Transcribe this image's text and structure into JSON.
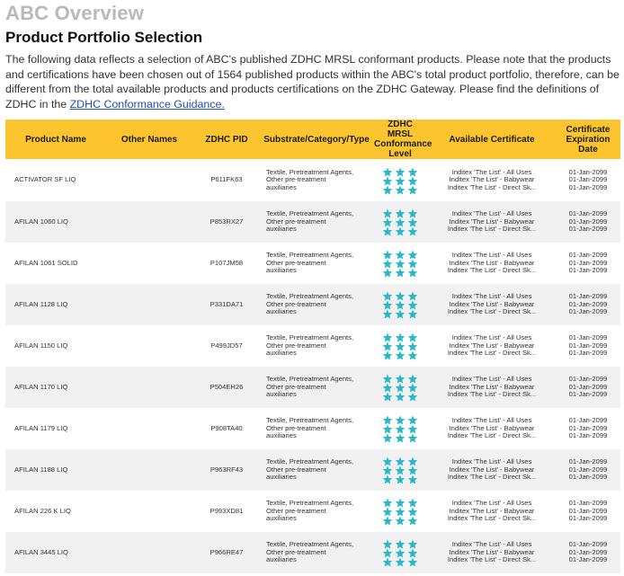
{
  "page": {
    "overview_title": "ABC Overview",
    "section_title": "Product Portfolio Selection",
    "intro_text": "The following data reflects a selection of ABC's published ZDHC MRSL conformant products. Please note that the products and certifications have been chosen out of 1564 published products within the ABC's total product portfolio, therefore, can be different from the total available products and products certifications on the ZDHC Gateway.  Please find the definitions of ZDHC in the ",
    "intro_link": "ZDHC Conformance Guidance.",
    "accent_color": "#fcc52f",
    "star_color": "#29b8c9",
    "link_color": "#1f4fb4"
  },
  "table": {
    "headers": {
      "product_name": "Product Name",
      "other_names": "Other Names",
      "pid": "ZDHC PID",
      "substrate": "Substrate/Category/Type",
      "mrsl_line1": "ZDHC MRSL",
      "mrsl_line2": "Conformance",
      "mrsl_line3": "Level",
      "certificate": "Available Certificate",
      "exp_line1": "Certificate",
      "exp_line2": "Expiration",
      "exp_line3": "Date"
    },
    "rows": [
      {
        "name": "ACTIVATOR SF LIQ",
        "other": "",
        "pid": "P611FK63",
        "sub1": "Textile, Pretreatment Agents,",
        "sub2": "Other pre-treatment",
        "sub3": "auxiliaries",
        "level": 3,
        "cert1": "Inditex 'The List' - All Uses",
        "cert2": "Inditex 'The List' - Babywear",
        "cert3": "Inditex 'The List' - Direct Sk...",
        "exp1": "01-Jan-2099",
        "exp2": "01-Jan-2099",
        "exp3": "01-Jan-2099"
      },
      {
        "name": "AFILAN 1060 LIQ",
        "other": "",
        "pid": "P853RX27",
        "sub1": "Textile, Pretreatment Agents,",
        "sub2": "Other pre-treatment",
        "sub3": "auxiliaries",
        "level": 3,
        "cert1": "Inditex 'The List' - All Uses",
        "cert2": "Inditex 'The List' - Babywear",
        "cert3": "Inditex 'The List' - Direct Sk...",
        "exp1": "01-Jan-2099",
        "exp2": "01-Jan-2099",
        "exp3": "01-Jan-2099"
      },
      {
        "name": "AFILAN 1061 SOLID",
        "other": "",
        "pid": "P107JM58",
        "sub1": "Textile, Pretreatment Agents,",
        "sub2": "Other pre-treatment",
        "sub3": "auxiliaries",
        "level": 3,
        "cert1": "Inditex 'The List' - All Uses",
        "cert2": "Inditex 'The List' - Babywear",
        "cert3": "Inditex 'The List' - Direct Sk...",
        "exp1": "01-Jan-2099",
        "exp2": "01-Jan-2099",
        "exp3": "01-Jan-2099"
      },
      {
        "name": "AFILAN 1128 LIQ",
        "other": "",
        "pid": "P331DA71",
        "sub1": "Textile, Pretreatment Agents,",
        "sub2": "Other pre-treatment",
        "sub3": "auxiliaries",
        "level": 3,
        "cert1": "Inditex 'The List' - All Uses",
        "cert2": "Inditex 'The List' - Babywear",
        "cert3": "Inditex 'The List' - Direct Sk...",
        "exp1": "01-Jan-2099",
        "exp2": "01-Jan-2099",
        "exp3": "01-Jan-2099"
      },
      {
        "name": "AFILAN 1150 LIQ",
        "other": "",
        "pid": "P499JD57",
        "sub1": "Textile, Pretreatment Agents,",
        "sub2": "Other pre-treatment",
        "sub3": "auxiliaries",
        "level": 3,
        "cert1": "Inditex 'The List' - All Uses",
        "cert2": "Inditex 'The List' - Babywear",
        "cert3": "Inditex 'The List' - Direct Sk...",
        "exp1": "01-Jan-2099",
        "exp2": "01-Jan-2099",
        "exp3": "01-Jan-2099"
      },
      {
        "name": "AFILAN 1170 LIQ",
        "other": "",
        "pid": "P504EH26",
        "sub1": "Textile, Pretreatment Agents,",
        "sub2": "Other pre-treatment",
        "sub3": "auxiliaries",
        "level": 3,
        "cert1": "Inditex 'The List' - All Uses",
        "cert2": "Inditex 'The List' - Babywear",
        "cert3": "Inditex 'The List' - Direct Sk...",
        "exp1": "01-Jan-2099",
        "exp2": "01-Jan-2099",
        "exp3": "01-Jan-2099"
      },
      {
        "name": "AFILAN 1179 LIQ",
        "other": "",
        "pid": "P908TA40",
        "sub1": "Textile, Pretreatment Agents,",
        "sub2": "Other pre-treatment",
        "sub3": "auxiliaries",
        "level": 3,
        "cert1": "Inditex 'The List' - All Uses",
        "cert2": "Inditex 'The List' - Babywear",
        "cert3": "Inditex 'The List' - Direct Sk...",
        "exp1": "01-Jan-2099",
        "exp2": "01-Jan-2099",
        "exp3": "01-Jan-2099"
      },
      {
        "name": "AFILAN 1188 LIQ",
        "other": "",
        "pid": "P963RF43",
        "sub1": "Textile, Pretreatment Agents,",
        "sub2": "Other pre-treatment",
        "sub3": "auxiliaries",
        "level": 3,
        "cert1": "Inditex 'The List' - All Uses",
        "cert2": "Inditex 'The List' - Babywear",
        "cert3": "Inditex 'The List' - Direct Sk...",
        "exp1": "01-Jan-2099",
        "exp2": "01-Jan-2099",
        "exp3": "01-Jan-2099"
      },
      {
        "name": "AFILAN 226 K LIQ",
        "other": "",
        "pid": "P993XD81",
        "sub1": "Textile, Pretreatment Agents,",
        "sub2": "Other pre-treatment",
        "sub3": "auxiliaries",
        "level": 3,
        "cert1": "Inditex 'The List' - All Uses",
        "cert2": "Inditex 'The List' - Babywear",
        "cert3": "Inditex 'The List' - Direct Sk...",
        "exp1": "01-Jan-2099",
        "exp2": "01-Jan-2099",
        "exp3": "01-Jan-2099"
      },
      {
        "name": "AFILAN 3445 LIQ",
        "other": "",
        "pid": "P966RE47",
        "sub1": "Textile, Pretreatment Agents,",
        "sub2": "Other pre-treatment",
        "sub3": "auxiliaries",
        "level": 3,
        "cert1": "Inditex 'The List' - All Uses",
        "cert2": "Inditex 'The List' - Babywear",
        "cert3": "Inditex 'The List' - Direct Sk...",
        "exp1": "01-Jan-2099",
        "exp2": "01-Jan-2099",
        "exp3": "01-Jan-2099"
      }
    ]
  }
}
